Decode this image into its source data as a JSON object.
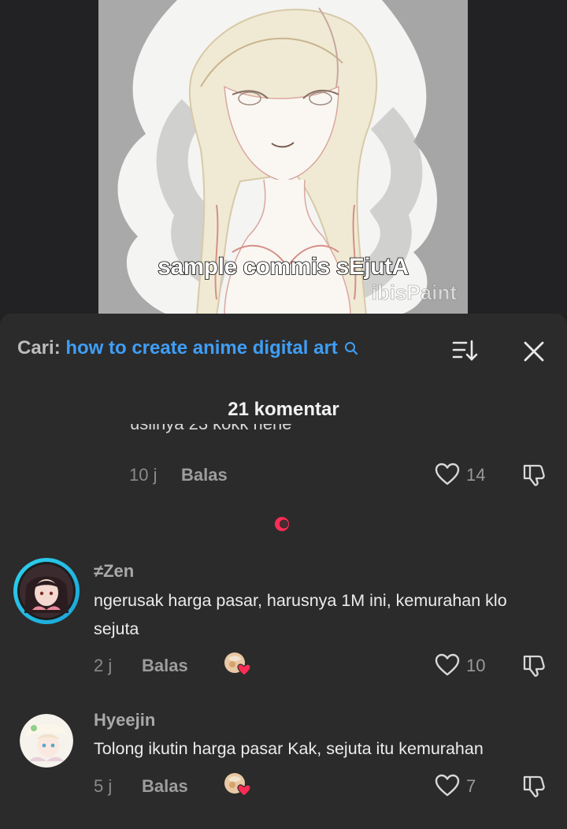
{
  "video": {
    "caption": "sample commis sEjutA",
    "watermark": "ibisPaint"
  },
  "sheet": {
    "search_prefix": "Cari:",
    "search_query": "how to create anime digital art",
    "comment_count": "21 komentar"
  },
  "comments": [
    {
      "text_cutoff": "usiinya 23 kokk hehe",
      "time": "10 j",
      "reply_label": "Balas",
      "likes": "14"
    },
    {
      "username": "≠Zen",
      "text": "ngerusak harga pasar, harusnya 1M ini, kemurahan klo sejuta",
      "time": "2 j",
      "reply_label": "Balas",
      "likes": "10"
    },
    {
      "username": "Hyeejin",
      "text": "Tolong ikutin harga pasar Kak, sejuta itu kemurahan",
      "time": "5 j",
      "reply_label": "Balas",
      "likes": "7"
    }
  ],
  "colors": {
    "background": "#1f1f1f",
    "sheet": "#2b2b2b",
    "search_accent": "#3f9ef6",
    "loading_dot": "#fe2c55",
    "avatar_ring": "#27c9e8"
  },
  "icons": [
    "search-icon",
    "sort-icon",
    "close-icon",
    "heart-icon",
    "dislike-icon",
    "creator-liked-heart-icon"
  ]
}
